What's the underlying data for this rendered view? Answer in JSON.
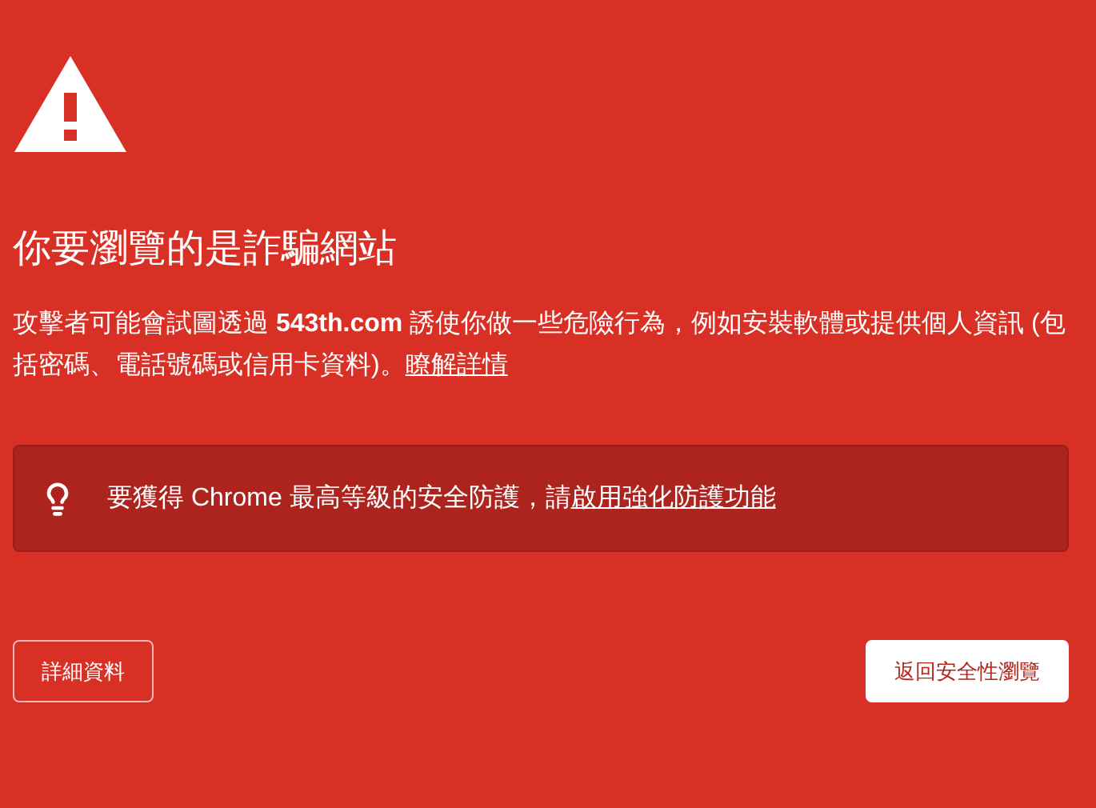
{
  "title": "你要瀏覽的是詐騙網站",
  "message": {
    "text": "攻擊者可能會試圖透過 **543th.com** 誘使你做一些危險行為，例如安裝軟體或提供個人資訊 (包括密碼、電話號碼或信用卡資料)。",
    "link": "瞭解詳情"
  },
  "notice": {
    "text": "要獲得 Chrome 最高等級的安全防護，請",
    "link": "啟用強化防護功能"
  },
  "buttons": [
    {
      "label": "詳細資料",
      "kind": "outline"
    },
    {
      "label": "返回安全性瀏覽",
      "kind": "primary"
    }
  ]
}
